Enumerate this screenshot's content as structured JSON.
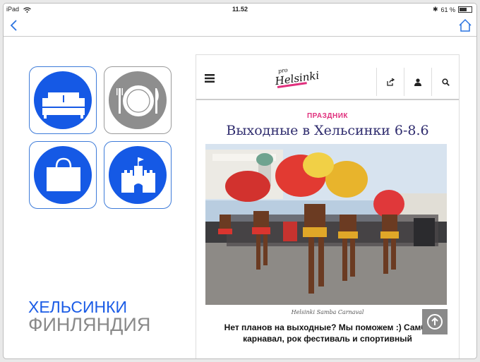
{
  "status": {
    "device": "iPad",
    "time": "11.52",
    "battery": "61 %",
    "battery_level": 0.61
  },
  "nav": {
    "back_icon": "chevron-left-icon",
    "home_icon": "home-icon"
  },
  "tiles": [
    {
      "name": "hotels",
      "icon": "bed-icon",
      "color": "#1559e5"
    },
    {
      "name": "restaurants",
      "icon": "plate-cutlery-icon",
      "color": "#8e8e8e"
    },
    {
      "name": "shopping",
      "icon": "shopping-bag-icon",
      "color": "#1559e5"
    },
    {
      "name": "sights",
      "icon": "castle-icon",
      "color": "#1559e5"
    }
  ],
  "city": {
    "name": "ХЕЛЬСИНКИ",
    "country": "ФИНЛЯНДИЯ"
  },
  "site": {
    "logo_small": "pro",
    "logo_main": "Helsinki",
    "category": "ПРАЗДНИК",
    "title": "Выходные в Хельсинки 6-8.6",
    "caption": "Helsinki Samba Carnaval",
    "lead_line1": "Нет планов на выходные? Мы поможем :) Самба",
    "lead_line2": "карнавал, рок фестиваль и спортивный"
  },
  "colors": {
    "accent_blue": "#1559e5",
    "pink": "#e0307d",
    "title_navy": "#2f2c6e"
  }
}
